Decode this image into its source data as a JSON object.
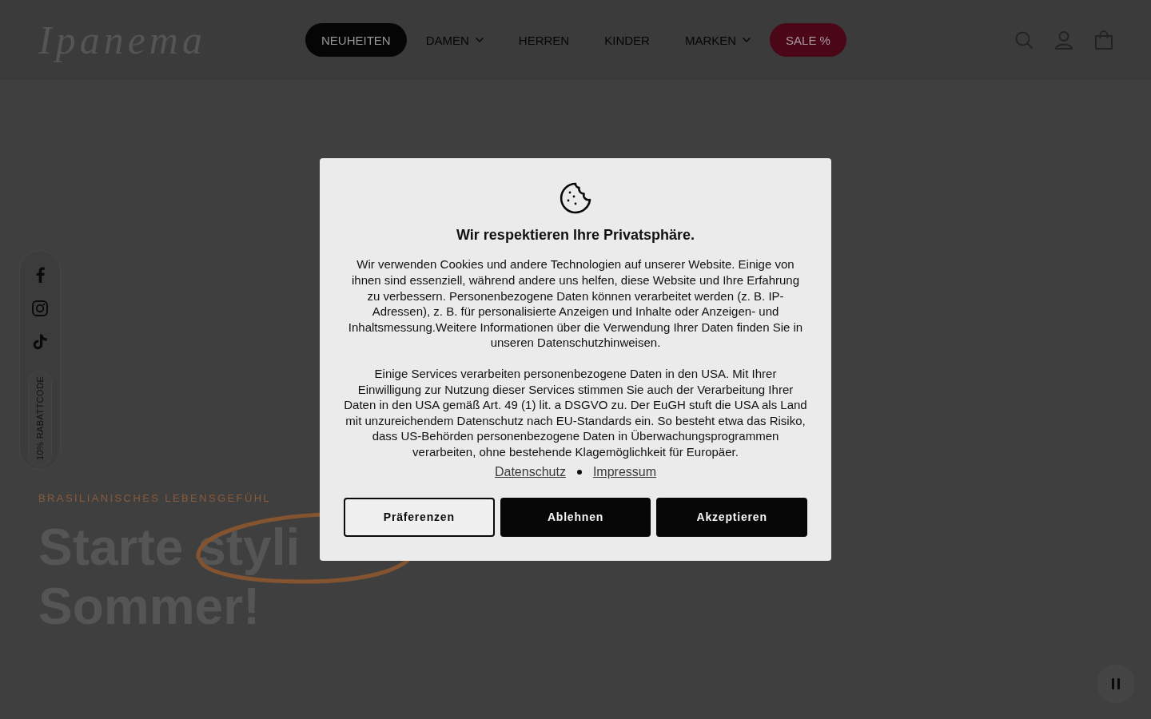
{
  "header": {
    "logo": "Ipanema",
    "nav": [
      {
        "label": "NEUHEITEN",
        "kind": "dark-pill",
        "has_dropdown": false
      },
      {
        "label": "DAMEN",
        "kind": "link",
        "has_dropdown": true
      },
      {
        "label": "HERREN",
        "kind": "link",
        "has_dropdown": false
      },
      {
        "label": "KINDER",
        "kind": "link",
        "has_dropdown": false
      },
      {
        "label": "MARKEN",
        "kind": "link",
        "has_dropdown": true
      },
      {
        "label": "SALE %",
        "kind": "sale-pill",
        "has_dropdown": false
      }
    ]
  },
  "social_bar": {
    "discount_label": "10% RABATTCODE"
  },
  "hero": {
    "eyebrow": "BRASILIANISCHES LEBENSGEFÜHL",
    "heading_lines": [
      "Starte styli",
      "Sommer!"
    ]
  },
  "cookie_dialog": {
    "title": "Wir respektieren Ihre Privatsphäre.",
    "paragraphs": [
      "Wir verwenden Cookies und andere Technologien auf unserer Website. Einige von ihnen sind essenziell, während andere uns helfen, diese Website und Ihre Erfahrung zu verbessern. Personenbezogene Daten können verarbeitet werden (z. B. IP-Adressen), z. B. für personalisierte Anzeigen und Inhalte oder Anzeigen- und Inhaltsmessung.Weitere Informationen über die Verwendung Ihrer Daten finden Sie in unseren Datenschutzhinweisen.",
      "Einige Services verarbeiten personenbezogene Daten in den USA. Mit Ihrer Einwilligung zur Nutzung dieser Services stimmen Sie auch der Verarbeitung Ihrer Daten in den USA gemäß Art. 49 (1) lit. a DSGVO zu. Der EuGH stuft die USA als Land mit unzureichendem Datenschutz nach EU-Standards ein. So besteht etwa das Risiko, dass US-Behörden personenbezogene Daten in Überwachungsprogrammen verarbeiten, ohne bestehende Klagemöglichkeit für Europäer."
    ],
    "links": [
      "Datenschutz",
      "Impressum"
    ],
    "buttons": [
      {
        "label": "Präferenzen",
        "kind": "outline"
      },
      {
        "label": "Ablehnen",
        "kind": "filled"
      },
      {
        "label": "Akzeptieren",
        "kind": "filled"
      }
    ]
  }
}
